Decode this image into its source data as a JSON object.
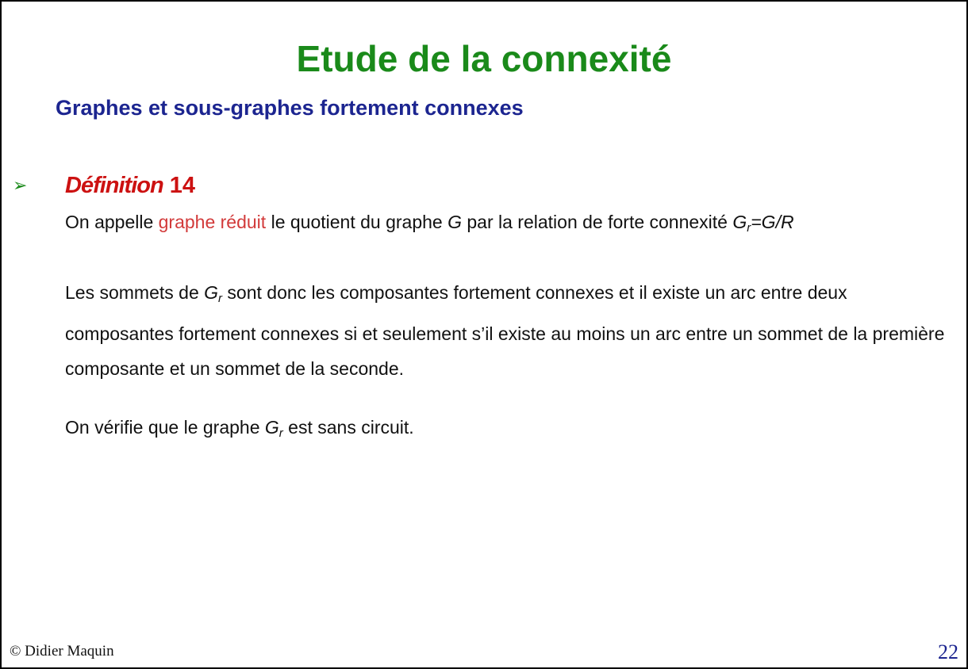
{
  "slide": {
    "title": "Etude de la connexité",
    "subtitle": "Graphes et sous-graphes fortement connexes",
    "bullet_symbol": "➢",
    "definition": {
      "label": "Définition",
      "number": "14"
    },
    "paragraph1": {
      "part1": "On appelle ",
      "highlight": "graphe réduit",
      "part2": "  le quotient du graphe ",
      "g": "G",
      "part3": " par la relation de forte connexité ",
      "gr_base": "G",
      "gr_sub": "r",
      "formula": "=G/R"
    },
    "paragraph2": {
      "part1": "Les sommets de ",
      "gr_base": "G",
      "gr_sub": "r",
      "part2": " sont donc les composantes fortement connexes et il existe un arc entre deux composantes fortement connexes si et seulement s’il existe au moins un arc entre un sommet de la première composante et un sommet de la seconde."
    },
    "paragraph3": {
      "part1": "On vérifie que le graphe ",
      "gr_base": "G",
      "gr_sub": "r",
      "part2": " est sans circuit."
    },
    "footer": {
      "author": "© Didier Maquin",
      "page_number": "22"
    }
  }
}
